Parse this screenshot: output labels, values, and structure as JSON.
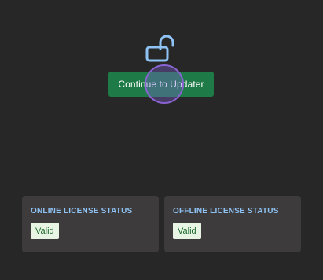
{
  "unlock": {
    "icon": "unlocked-padlock-icon",
    "icon_color": "#8fc3f5"
  },
  "actions": {
    "continue_label": "Continue to Updater",
    "continue_color": "#1e7a46"
  },
  "license": {
    "online": {
      "title": "ONLINE LICENSE STATUS",
      "status": "Valid"
    },
    "offline": {
      "title": "OFFLINE LICENSE STATUS",
      "status": "Valid"
    }
  }
}
